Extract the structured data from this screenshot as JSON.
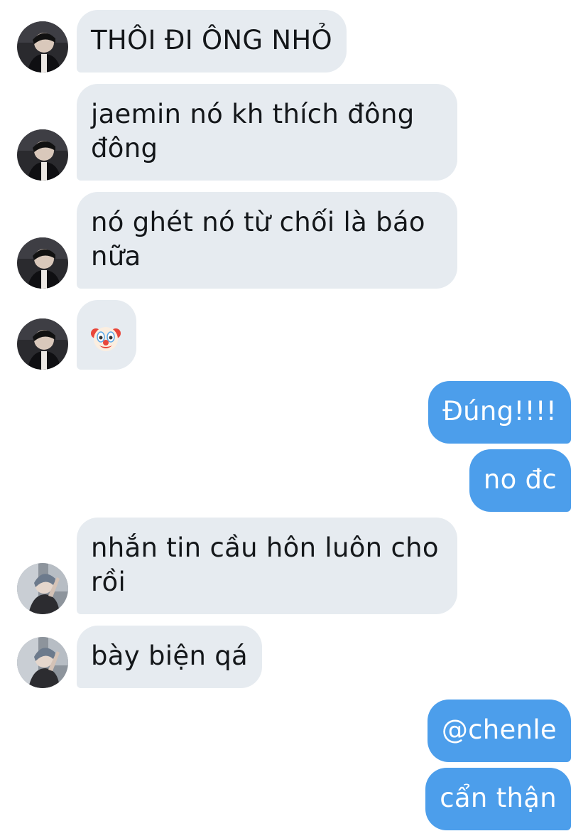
{
  "conversation": {
    "messages": [
      {
        "direction": "in",
        "sender": "avatar-dark",
        "text": "THÔI ĐI ÔNG NHỎ"
      },
      {
        "direction": "in",
        "sender": "avatar-dark",
        "text": "jaemin nó kh thích đông đông"
      },
      {
        "direction": "in",
        "sender": "avatar-dark",
        "text": "nó ghét nó từ chối là báo nữa"
      },
      {
        "direction": "in",
        "sender": "avatar-dark",
        "text": "",
        "emoji": "clown-face-icon"
      },
      {
        "direction": "out",
        "text": "Đúng!!!!"
      },
      {
        "direction": "out",
        "text": "no đc"
      },
      {
        "direction": "in",
        "sender": "avatar-light",
        "text": "nhắn tin cầu hôn luôn cho rồi"
      },
      {
        "direction": "in",
        "sender": "avatar-light",
        "text": "bày biện qá"
      },
      {
        "direction": "out",
        "text": "@chenle"
      },
      {
        "direction": "out",
        "text": "cẩn thận"
      }
    ]
  },
  "colors": {
    "incoming_bubble": "#e6ebf0",
    "incoming_text": "#14171a",
    "outgoing_bubble": "#4c9eeb",
    "outgoing_text": "#ffffff",
    "background": "#ffffff"
  }
}
